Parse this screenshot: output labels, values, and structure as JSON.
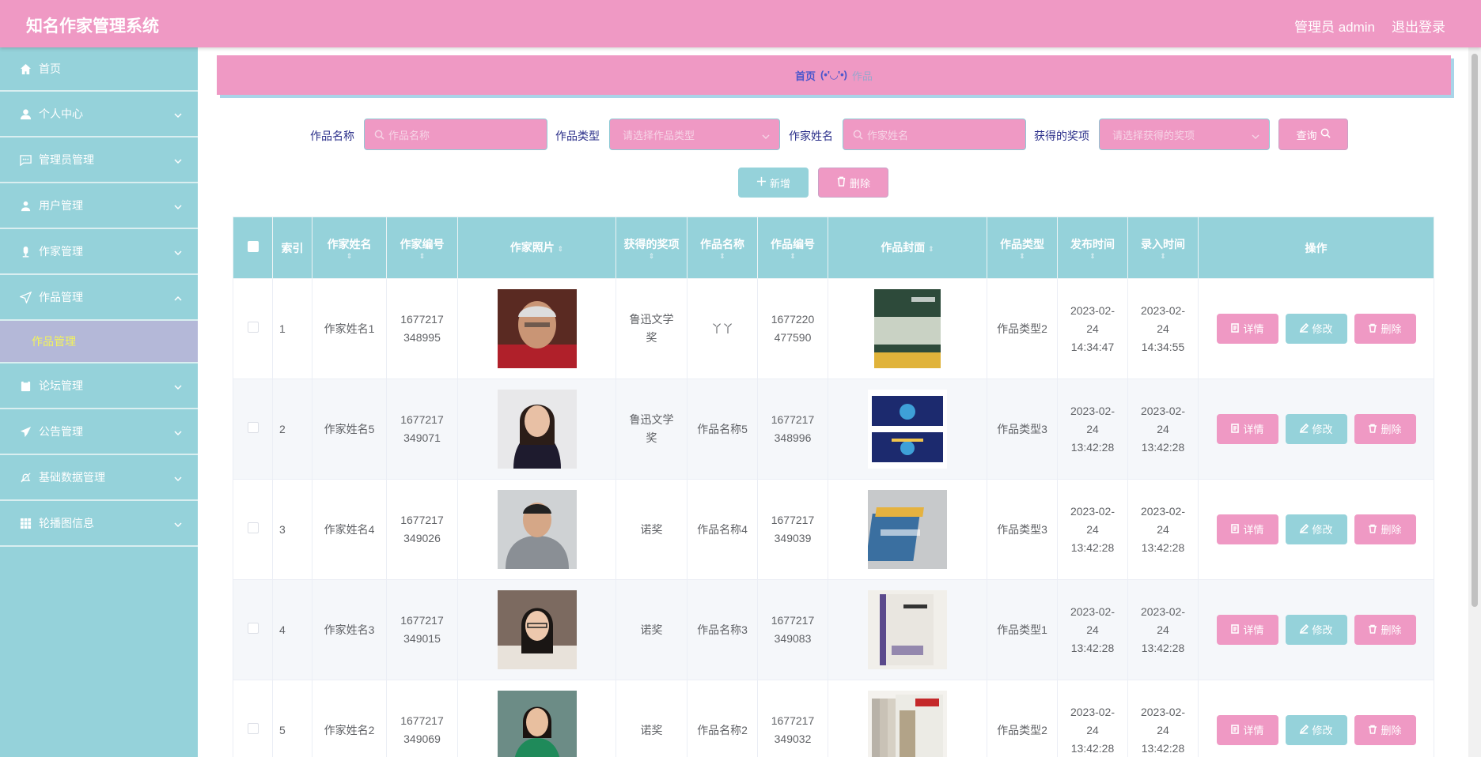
{
  "header": {
    "title": "知名作家管理系统",
    "user": "管理员 admin",
    "logout": "退出登录"
  },
  "sidebar": {
    "items": [
      {
        "label": "首页"
      },
      {
        "label": "个人中心"
      },
      {
        "label": "管理员管理"
      },
      {
        "label": "用户管理"
      },
      {
        "label": "作家管理"
      },
      {
        "label": "作品管理"
      },
      {
        "label": "论坛管理"
      },
      {
        "label": "公告管理"
      },
      {
        "label": "基础数据管理"
      },
      {
        "label": "轮播图信息"
      }
    ],
    "active_sub": "作品管理"
  },
  "breadcrumb": {
    "home": "首页",
    "face": "(•'◡'•)",
    "current": "作品"
  },
  "search": {
    "work_name_label": "作品名称",
    "work_name_placeholder": "作品名称",
    "work_type_label": "作品类型",
    "work_type_placeholder": "请选择作品类型",
    "author_name_label": "作家姓名",
    "author_name_placeholder": "作家姓名",
    "award_label": "获得的奖项",
    "award_placeholder": "请选择获得的奖项",
    "query_button": "查询"
  },
  "actions": {
    "add": "新增",
    "delete": "删除"
  },
  "table": {
    "headers": [
      "索引",
      "作家姓名",
      "作家编号",
      "作家照片",
      "获得的奖项",
      "作品名称",
      "作品编号",
      "作品封面",
      "作品类型",
      "发布时间",
      "录入时间",
      "操作"
    ],
    "sort_symbol": "⇕",
    "row_buttons": {
      "detail": "详情",
      "edit": "修改",
      "delete": "删除"
    },
    "rows": [
      {
        "index": "1",
        "author": "作家姓名1",
        "author_id": "1677217348995",
        "award": "鲁迅文学奖",
        "work": "丫丫",
        "work_id": "1677220477590",
        "type": "作品类型2",
        "publish": "2023-02-24 14:34:47",
        "entry": "2023-02-24 14:34:55"
      },
      {
        "index": "2",
        "author": "作家姓名5",
        "author_id": "1677217349071",
        "award": "鲁迅文学奖",
        "work": "作品名称5",
        "work_id": "1677217348996",
        "type": "作品类型3",
        "publish": "2023-02-24 13:42:28",
        "entry": "2023-02-24 13:42:28"
      },
      {
        "index": "3",
        "author": "作家姓名4",
        "author_id": "1677217349026",
        "award": "诺奖",
        "work": "作品名称4",
        "work_id": "1677217349039",
        "type": "作品类型3",
        "publish": "2023-02-24 13:42:28",
        "entry": "2023-02-24 13:42:28"
      },
      {
        "index": "4",
        "author": "作家姓名3",
        "author_id": "1677217349015",
        "award": "诺奖",
        "work": "作品名称3",
        "work_id": "1677217349083",
        "type": "作品类型1",
        "publish": "2023-02-24 13:42:28",
        "entry": "2023-02-24 13:42:28"
      },
      {
        "index": "5",
        "author": "作家姓名2",
        "author_id": "1677217349069",
        "award": "诺奖",
        "work": "作品名称2",
        "work_id": "1677217349032",
        "type": "作品类型2",
        "publish": "2023-02-24 13:42:28",
        "entry": "2023-02-24 13:42:28"
      }
    ]
  },
  "colors": {
    "primary_pink": "#ef99c4",
    "teal": "#95d2da",
    "active_sub_text": "#f3f35a",
    "breadcrumb_link": "#4a56cc"
  }
}
